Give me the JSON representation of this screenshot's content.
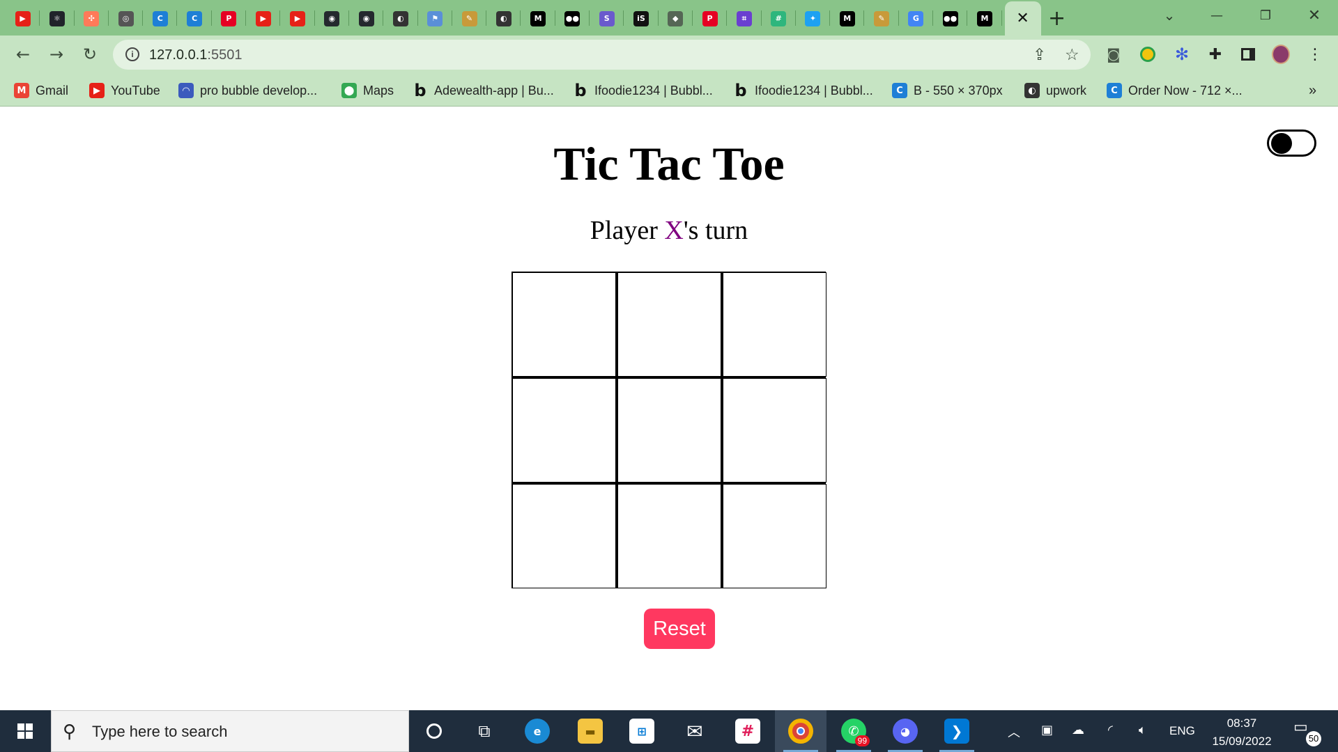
{
  "browser": {
    "pinned_tabs": [
      {
        "icon": "youtube-icon",
        "glyph": "▶",
        "color": "#e62117"
      },
      {
        "icon": "react-icon",
        "glyph": "⚛",
        "color": "#20232a"
      },
      {
        "icon": "hubspot-icon",
        "glyph": "✣",
        "color": "#ff7a59"
      },
      {
        "icon": "chrome-icon",
        "glyph": "◎",
        "color": "#555555"
      },
      {
        "icon": "canva-icon",
        "glyph": "C",
        "color": "#1e7fd6"
      },
      {
        "icon": "canva-icon",
        "glyph": "C",
        "color": "#1e7fd6"
      },
      {
        "icon": "pinterest-icon",
        "glyph": "P",
        "color": "#e60023"
      },
      {
        "icon": "youtube-icon",
        "glyph": "▶",
        "color": "#e62117"
      },
      {
        "icon": "youtube-icon",
        "glyph": "▶",
        "color": "#e62117"
      },
      {
        "icon": "github-icon",
        "glyph": "◉",
        "color": "#24292e"
      },
      {
        "icon": "github-icon",
        "glyph": "◉",
        "color": "#24292e"
      },
      {
        "icon": "globe-icon",
        "glyph": "◐",
        "color": "#333333"
      },
      {
        "icon": "flag-icon",
        "glyph": "⚑",
        "color": "#5a8fd8"
      },
      {
        "icon": "feather-icon",
        "glyph": "✎",
        "color": "#c89a3a"
      },
      {
        "icon": "globe-icon",
        "glyph": "◐",
        "color": "#333333"
      },
      {
        "icon": "medium-icon",
        "glyph": "M",
        "color": "#000000"
      },
      {
        "icon": "medium-icon",
        "glyph": "●●",
        "color": "#000000"
      },
      {
        "icon": "stackbit-icon",
        "glyph": "S",
        "color": "#6a5acd"
      },
      {
        "icon": "is-icon",
        "glyph": "iS",
        "color": "#111111"
      },
      {
        "icon": "layers-icon",
        "glyph": "◆",
        "color": "#556655"
      },
      {
        "icon": "pinterest-icon",
        "glyph": "P",
        "color": "#e60023"
      },
      {
        "icon": "hashnode-icon",
        "glyph": "⌗",
        "color": "#6a3fd0"
      },
      {
        "icon": "slack-icon",
        "glyph": "#",
        "color": "#2eb67d"
      },
      {
        "icon": "twitter-icon",
        "glyph": "✦",
        "color": "#1da1f2"
      },
      {
        "icon": "medium-icon",
        "glyph": "M",
        "color": "#000000"
      },
      {
        "icon": "feather-icon",
        "glyph": "✎",
        "color": "#c89a3a"
      },
      {
        "icon": "google-icon",
        "glyph": "G",
        "color": "#4285f4"
      },
      {
        "icon": "medium-icon",
        "glyph": "●●",
        "color": "#000000"
      },
      {
        "icon": "medium-icon",
        "glyph": "M",
        "color": "#000000"
      }
    ],
    "active_tab_close": "✕",
    "new_tab": "+",
    "url_host": "127.0.0.1",
    "url_port": ":5501",
    "bookmarks": [
      {
        "label": "Gmail",
        "icon": "gmail-icon",
        "glyph": "M",
        "color": "#ea4335"
      },
      {
        "label": "YouTube",
        "icon": "youtube-icon",
        "glyph": "▶",
        "color": "#e62117"
      },
      {
        "label": "pro bubble develop...",
        "icon": "udemy-icon",
        "glyph": "◠",
        "color": "#3c5bbd"
      },
      {
        "label": "Maps",
        "icon": "maps-icon",
        "glyph": "⬤",
        "color": "#34a853"
      },
      {
        "label": "Adewealth-app | Bu...",
        "icon": "bubble-icon",
        "glyph": "b",
        "color": ""
      },
      {
        "label": "Ifoodie1234 | Bubbl...",
        "icon": "bubble-icon",
        "glyph": "b",
        "color": ""
      },
      {
        "label": "Ifoodie1234 | Bubbl...",
        "icon": "bubble-icon",
        "glyph": "b",
        "color": ""
      },
      {
        "label": "B - 550 × 370px",
        "icon": "canva-icon",
        "glyph": "C",
        "color": "#1e7fd6"
      },
      {
        "label": "upwork",
        "icon": "globe-icon",
        "glyph": "◐",
        "color": "#333333"
      },
      {
        "label": "Order Now - 712 ×...",
        "icon": "canva-icon",
        "glyph": "C",
        "color": "#1e7fd6"
      }
    ],
    "bookmarks_overflow": "»"
  },
  "game": {
    "title": "Tic Tac Toe",
    "status_prefix": "Player ",
    "current_player": "X",
    "status_suffix": "'s turn",
    "player_color": "#800080",
    "board": [
      "",
      "",
      "",
      "",
      "",
      "",
      "",
      "",
      ""
    ],
    "reset_label": "Reset",
    "reset_color": "#ff3860",
    "theme_toggle_on": false
  },
  "taskbar": {
    "search_placeholder": "Type here to search",
    "whatsapp_badge": "99",
    "language": "ENG",
    "time": "08:37",
    "date": "15/09/2022",
    "notification_count": "50"
  }
}
